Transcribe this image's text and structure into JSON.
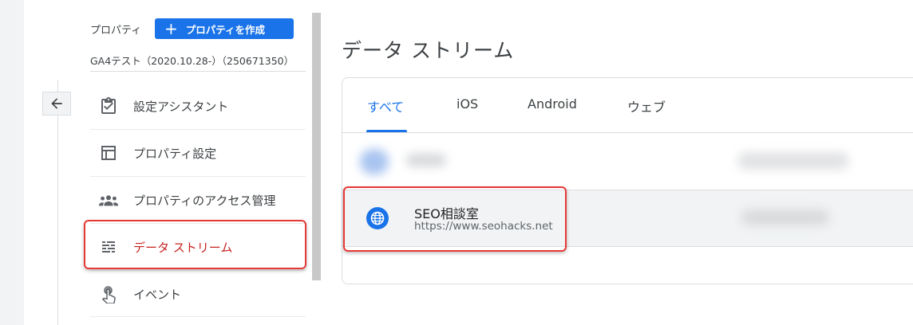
{
  "property": {
    "label": "プロパティ",
    "create_button": "プロパティを作成",
    "name": "GA4テスト（2020.10.28-）（250671350）"
  },
  "nav": {
    "items": [
      {
        "label": "設定アシスタント",
        "icon": "clipboard-check-icon"
      },
      {
        "label": "プロパティ設定",
        "icon": "layout-icon"
      },
      {
        "label": "プロパティのアクセス管理",
        "icon": "people-icon"
      },
      {
        "label": "データ ストリーム",
        "icon": "data-stream-icon",
        "active": true
      },
      {
        "label": "イベント",
        "icon": "touch-icon"
      }
    ]
  },
  "main": {
    "title": "データ ストリーム",
    "tabs": [
      {
        "label": "すべて",
        "active": true
      },
      {
        "label": "iOS"
      },
      {
        "label": "Android"
      },
      {
        "label": "ウェブ"
      }
    ],
    "streams": [
      {
        "name": "SEO相談室",
        "url": "https://www.seohacks.net",
        "icon": "globe-icon"
      }
    ]
  },
  "colors": {
    "accent": "#1a73e8",
    "highlight": "#e53935",
    "active_nav": "#c5221f"
  }
}
